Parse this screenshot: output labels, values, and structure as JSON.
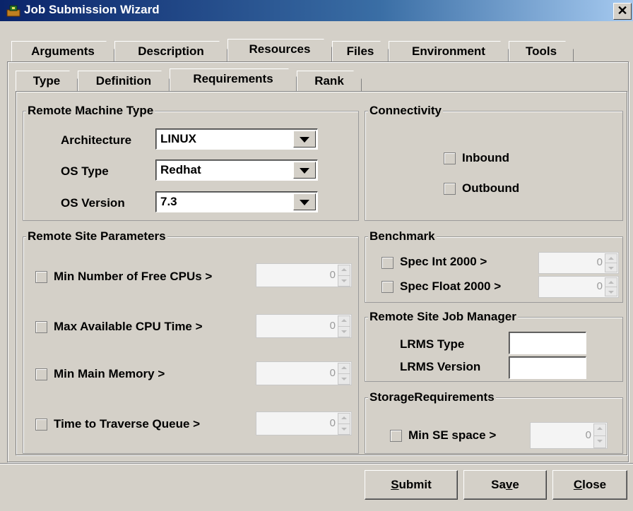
{
  "window": {
    "title": "Job Submission Wizard",
    "close_glyph": "✕"
  },
  "main_tabs": [
    "Arguments",
    "Description",
    "Resources",
    "Files",
    "Environment",
    "Tools"
  ],
  "main_tab_selected": "Resources",
  "sub_tabs": [
    "Type",
    "Definition",
    "Requirements",
    "Rank"
  ],
  "sub_tab_selected": "Requirements",
  "remote_machine_type": {
    "title": "Remote Machine Type",
    "architecture": {
      "label": "Architecture",
      "value": "LINUX"
    },
    "os_type": {
      "label": "OS Type",
      "value": "Redhat"
    },
    "os_version": {
      "label": "OS Version",
      "value": "7.3"
    }
  },
  "connectivity": {
    "title": "Connectivity",
    "inbound": {
      "label": "Inbound",
      "checked": false
    },
    "outbound": {
      "label": "Outbound",
      "checked": false
    }
  },
  "remote_site_parameters": {
    "title": "Remote Site Parameters",
    "items": [
      {
        "label": "Min Number of Free CPUs >",
        "value": "0",
        "checked": false
      },
      {
        "label": "Max Available CPU Time >",
        "value": "0",
        "checked": false
      },
      {
        "label": "Min Main Memory >",
        "value": "0",
        "checked": false
      },
      {
        "label": "Time to Traverse Queue >",
        "value": "0",
        "checked": false
      }
    ]
  },
  "benchmark": {
    "title": "Benchmark",
    "items": [
      {
        "label": "Spec Int 2000 >",
        "value": "0",
        "checked": false
      },
      {
        "label": "Spec Float 2000 >",
        "value": "0",
        "checked": false
      }
    ]
  },
  "job_manager": {
    "title": "Remote Site Job Manager",
    "lrms_type_label": "LRMS Type",
    "lrms_type_value": "",
    "lrms_version_label": "LRMS Version",
    "lrms_version_value": ""
  },
  "storage": {
    "title": "StorageRequirements",
    "min_se": {
      "label": "Min SE space >",
      "value": "0",
      "checked": false
    }
  },
  "buttons": {
    "submit": {
      "mnemonic": "S",
      "rest": "ubmit"
    },
    "save": {
      "pre": "Sa",
      "mnemonic": "v",
      "rest": "e"
    },
    "close": {
      "mnemonic": "C",
      "rest": "lose"
    }
  }
}
